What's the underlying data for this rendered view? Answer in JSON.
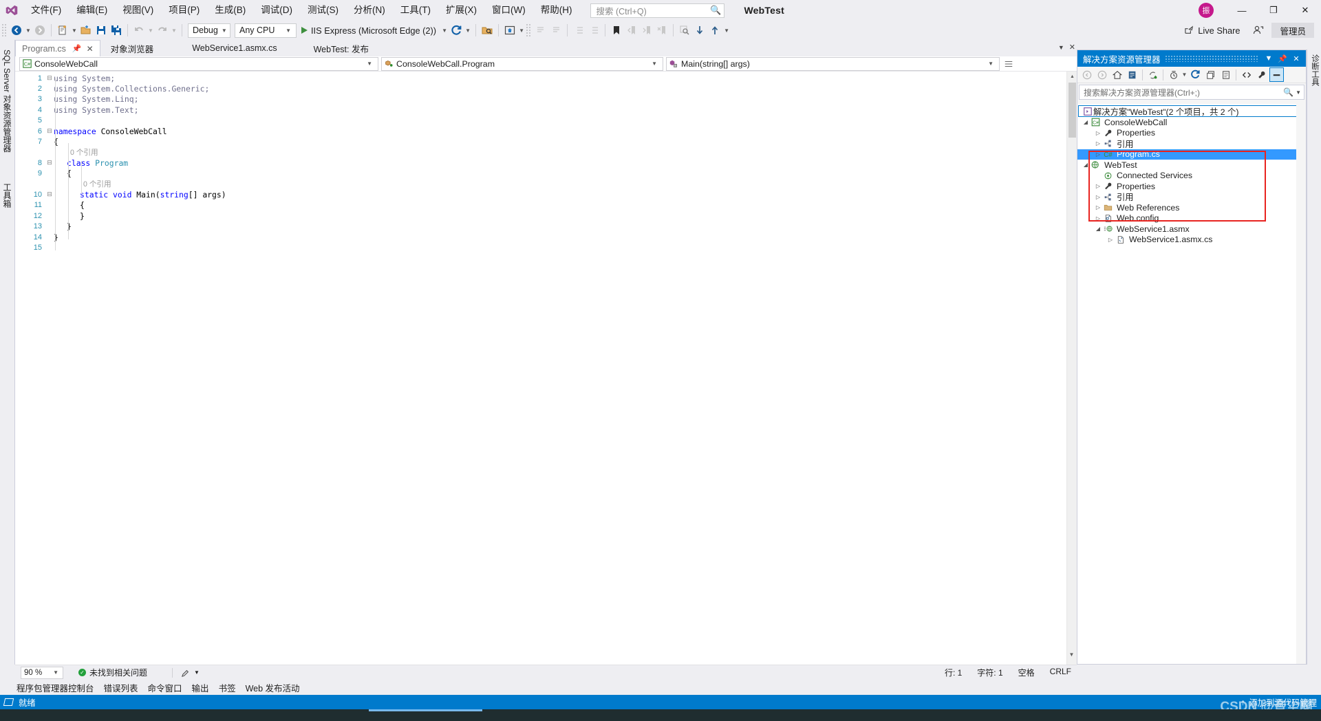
{
  "window": {
    "solution_name": "WebTest",
    "avatar_initial": "振",
    "minimize": "—",
    "restore": "❐",
    "close": "✕"
  },
  "menu": {
    "items": [
      {
        "label": "文件(F)",
        "key": "F"
      },
      {
        "label": "编辑(E)",
        "key": "E"
      },
      {
        "label": "视图(V)",
        "key": "V"
      },
      {
        "label": "项目(P)",
        "key": "P"
      },
      {
        "label": "生成(B)",
        "key": "B"
      },
      {
        "label": "调试(D)",
        "key": "D"
      },
      {
        "label": "测试(S)",
        "key": "S"
      },
      {
        "label": "分析(N)",
        "key": "N"
      },
      {
        "label": "工具(T)",
        "key": "T"
      },
      {
        "label": "扩展(X)",
        "key": "X"
      },
      {
        "label": "窗口(W)",
        "key": "W"
      },
      {
        "label": "帮助(H)",
        "key": "H"
      }
    ]
  },
  "search": {
    "placeholder": "搜索 (Ctrl+Q)",
    "value": ""
  },
  "toolbar": {
    "configuration": "Debug",
    "platform": "Any CPU",
    "run_target": "IIS Express (Microsoft Edge (2))",
    "live_share": "Live Share",
    "admin_badge": "管理员"
  },
  "left_dock": {
    "tabs": [
      "SQL Server 对象资源管理器",
      "工具箱"
    ]
  },
  "right_dock": {
    "tabs": [
      "诊断工具"
    ]
  },
  "document_tabs": [
    {
      "label": "Program.cs",
      "active": true,
      "pinned": true,
      "closable": true
    },
    {
      "label": "对象浏览器",
      "active": false
    },
    {
      "label": "WebService1.asmx.cs",
      "active": false
    },
    {
      "label": "WebTest: 发布",
      "active": false
    }
  ],
  "nav_bar": {
    "project": "ConsoleWebCall",
    "type": "ConsoleWebCall.Program",
    "member": "Main(string[] args)"
  },
  "code": {
    "lines": [
      {
        "num": "1",
        "fold": "−",
        "indent": 0,
        "tokens": [
          {
            "t": "using ",
            "c": "usingclr"
          },
          {
            "t": "System;",
            "c": "usingclr"
          }
        ]
      },
      {
        "num": "2",
        "fold": "",
        "indent": 0,
        "tokens": [
          {
            "t": "using System.Collections.Generic;",
            "c": "usingclr"
          }
        ]
      },
      {
        "num": "3",
        "fold": "",
        "indent": 0,
        "tokens": [
          {
            "t": "using System.Linq;",
            "c": "usingclr"
          }
        ]
      },
      {
        "num": "4",
        "fold": "",
        "indent": 0,
        "tokens": [
          {
            "t": "using System.Text;",
            "c": "usingclr"
          }
        ]
      },
      {
        "num": "5",
        "fold": "",
        "indent": 0,
        "tokens": []
      },
      {
        "num": "6",
        "fold": "−",
        "indent": 0,
        "tokens": [
          {
            "t": "namespace ",
            "c": "kw"
          },
          {
            "t": "ConsoleWebCall",
            "c": "plain"
          }
        ]
      },
      {
        "num": "7",
        "fold": "",
        "indent": 0,
        "tokens": [
          {
            "t": "{",
            "c": "plain"
          }
        ]
      },
      {
        "num": "",
        "fold": "",
        "indent": 1,
        "codelens": "0 个引用"
      },
      {
        "num": "8",
        "fold": "−",
        "indent": 1,
        "tokens": [
          {
            "t": "class ",
            "c": "kw"
          },
          {
            "t": "Program",
            "c": "type"
          }
        ]
      },
      {
        "num": "9",
        "fold": "",
        "indent": 1,
        "tokens": [
          {
            "t": "{",
            "c": "plain"
          }
        ]
      },
      {
        "num": "",
        "fold": "",
        "indent": 2,
        "codelens": "0 个引用"
      },
      {
        "num": "10",
        "fold": "−",
        "indent": 2,
        "tokens": [
          {
            "t": "static void ",
            "c": "kw"
          },
          {
            "t": "Main(",
            "c": "plain"
          },
          {
            "t": "string",
            "c": "kw"
          },
          {
            "t": "[] args)",
            "c": "plain"
          }
        ]
      },
      {
        "num": "11",
        "fold": "",
        "indent": 2,
        "tokens": [
          {
            "t": "{",
            "c": "plain"
          }
        ]
      },
      {
        "num": "12",
        "fold": "",
        "indent": 2,
        "tokens": [
          {
            "t": "}",
            "c": "plain"
          }
        ]
      },
      {
        "num": "13",
        "fold": "",
        "indent": 1,
        "tokens": [
          {
            "t": "}",
            "c": "plain"
          }
        ]
      },
      {
        "num": "14",
        "fold": "",
        "indent": 0,
        "tokens": [
          {
            "t": "}",
            "c": "plain"
          }
        ]
      },
      {
        "num": "15",
        "fold": "",
        "indent": 0,
        "tokens": []
      }
    ]
  },
  "editor_status": {
    "zoom": "90 %",
    "issues": "未找到相关问题",
    "line_label": "行: 1",
    "char_label": "字符: 1",
    "indent_label": "空格",
    "eol_label": "CRLF"
  },
  "bottom_tabs": [
    "程序包管理器控制台",
    "错误列表",
    "命令窗口",
    "输出",
    "书签",
    "Web 发布活动"
  ],
  "status_bar": {
    "state": "就绪",
    "source_control": "添加到源代码管理",
    "arrow": "↑"
  },
  "watermark": "CSDN @音尘啊",
  "solution_explorer": {
    "title": "解决方案资源管理器",
    "search_placeholder": "搜索解决方案资源管理器(Ctrl+;)",
    "solution_row": "解决方案\"WebTest\"(2 个项目，共 2 个)",
    "tree": [
      {
        "label": "ConsoleWebCall",
        "depth": 1,
        "arrow": "open",
        "icon": "csproj-icon",
        "selected": false
      },
      {
        "label": "Properties",
        "depth": 2,
        "arrow": "closed",
        "icon": "wrench-icon",
        "selected": false
      },
      {
        "label": "引用",
        "depth": 2,
        "arrow": "closed",
        "icon": "references-icon",
        "selected": false
      },
      {
        "label": "Program.cs",
        "depth": 2,
        "arrow": "closed",
        "icon": "csfile-icon",
        "selected": true
      },
      {
        "label": "WebTest",
        "depth": 1,
        "arrow": "open",
        "icon": "webproj-icon",
        "selected": false
      },
      {
        "label": "Connected Services",
        "depth": 2,
        "arrow": "none",
        "icon": "connected-services-icon",
        "selected": false
      },
      {
        "label": "Properties",
        "depth": 2,
        "arrow": "closed",
        "icon": "wrench-icon",
        "selected": false
      },
      {
        "label": "引用",
        "depth": 2,
        "arrow": "closed",
        "icon": "references-icon",
        "selected": false
      },
      {
        "label": "Web References",
        "depth": 2,
        "arrow": "closed",
        "icon": "folder-icon",
        "selected": false
      },
      {
        "label": "Web.config",
        "depth": 2,
        "arrow": "closed",
        "icon": "config-icon",
        "selected": false
      },
      {
        "label": "WebService1.asmx",
        "depth": 2,
        "arrow": "open",
        "icon": "asmx-icon",
        "selected": false
      },
      {
        "label": "WebService1.asmx.cs",
        "depth": 3,
        "arrow": "closed",
        "icon": "codefile-icon",
        "selected": false
      }
    ]
  },
  "colors": {
    "accent": "#007acc",
    "selection": "#3399ff",
    "highlight_box": "#e8231f",
    "keyword": "#0000ff",
    "type": "#2b91af",
    "linenum": "#2b91af"
  }
}
